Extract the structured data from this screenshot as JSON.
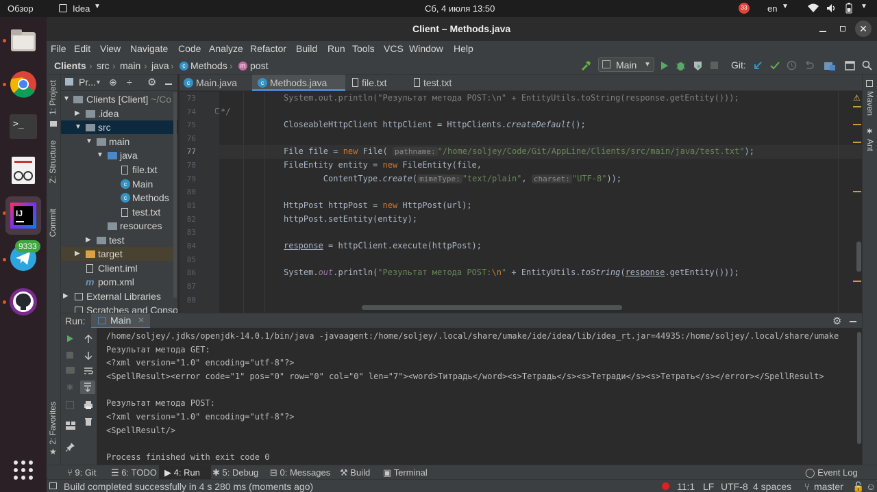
{
  "topbar": {
    "activities": "Обзор",
    "app_name": "Idea",
    "clock": "Сб, 4 июля  13:50",
    "lang": "en",
    "badge": "33"
  },
  "dock": {
    "telegram_badge": "9333"
  },
  "window": {
    "title": "Client – Methods.java"
  },
  "menu": [
    "File",
    "Edit",
    "View",
    "Navigate",
    "Code",
    "Analyze",
    "Refactor",
    "Build",
    "Run",
    "Tools",
    "VCS",
    "Window",
    "Help"
  ],
  "breadcrumbs": [
    "Clients",
    "src",
    "main",
    "java",
    "Methods",
    "post"
  ],
  "toolbar": {
    "run_config": "Main",
    "git_label": "Git:"
  },
  "project": {
    "header": "Pr...",
    "rows": [
      {
        "label": "Clients [Client]",
        "suffix": "~/Co"
      },
      {
        "label": ".idea"
      },
      {
        "label": "src"
      },
      {
        "label": "main"
      },
      {
        "label": "java"
      },
      {
        "label": "file.txt"
      },
      {
        "label": "Main"
      },
      {
        "label": "Methods"
      },
      {
        "label": "test.txt"
      },
      {
        "label": "resources"
      },
      {
        "label": "test"
      },
      {
        "label": "target"
      },
      {
        "label": "Client.iml"
      },
      {
        "label": "pom.xml"
      },
      {
        "label": "External Libraries"
      },
      {
        "label": "Scratches and Conso"
      }
    ]
  },
  "left_tabs": [
    "1: Project",
    "Z: Structure",
    "Commit",
    "2: Favorites"
  ],
  "right_tabs": [
    "Maven",
    "Ant"
  ],
  "tabs": [
    "Main.java",
    "Methods.java",
    "file.txt",
    "test.txt"
  ],
  "editor": {
    "line_numbers": [
      "73",
      "74",
      "75",
      "76",
      "77",
      "78",
      "79",
      "80",
      "81",
      "82",
      "83",
      "84",
      "85",
      "86",
      "87",
      "88"
    ],
    "l73_a": "System.",
    "l73_b": "out",
    "l73_c": ".println(",
    "l73_str": "\"Результат метода POST:\\n\"",
    "l73_d": " + EntityUtils.toString(response.getEntity()));",
    "l74": "*/",
    "l75_a": "CloseableHttpClient httpClient = HttpClients.",
    "l75_b": "createDefault",
    "l75_c": "();",
    "l77_a": "File file = ",
    "l77_kw": "new",
    "l77_b": " File(",
    "l77_hint": "pathname:",
    "l77_str": "\"/home/soljey/Code/Git/AppLine/Clients/src/main/java/test.txt\"",
    "l77_c": ");",
    "l78_a": "FileEntity entity = ",
    "l78_kw": "new",
    "l78_b": " FileEntity(file,",
    "l79_a": "        ContentType.",
    "l79_b": "create",
    "l79_c": "(",
    "l79_hint1": "mimeType:",
    "l79_str1": "\"text/plain\"",
    "l79_d": ",",
    "l79_hint2": "charset:",
    "l79_str2": "\"UTF-8\"",
    "l79_e": "));",
    "l81_a": "HttpPost httpPost = ",
    "l81_kw": "new",
    "l81_b": " HttpPost(url);",
    "l82": "httpPost.setEntity(entity);",
    "l84_a": "response",
    "l84_b": " = httpClient.execute(httpPost);",
    "l86_a": "System.",
    "l86_b": "out",
    "l86_c": ".println(",
    "l86_str": "\"Результат метода POST:",
    "l86_esc": "\\n",
    "l86_str2": "\"",
    "l86_d": " + EntityUtils.",
    "l86_e": "toString",
    "l86_f": "(",
    "l86_g": "response",
    "l86_h": ".getEntity()));"
  },
  "run": {
    "label": "Run:",
    "tab": "Main",
    "output": [
      "/home/soljey/.jdks/openjdk-14.0.1/bin/java -javaagent:/home/soljey/.local/share/umake/ide/idea/lib/idea_rt.jar=44935:/home/soljey/.local/share/umake",
      "Результат метода GET:",
      "<?xml version=\"1.0\" encoding=\"utf-8\"?>",
      "<SpellResult><error code=\"1\" pos=\"0\" row=\"0\" col=\"0\" len=\"7\"><word>Титрадь</word><s>Тетрадь</s><s>Тетради</s><s>Тетрать</s></error></SpellResult>",
      "",
      "Результат метода POST:",
      "<?xml version=\"1.0\" encoding=\"utf-8\"?>",
      "<SpellResult/>",
      "",
      "Process finished with exit code 0"
    ]
  },
  "tool_windows": [
    "9: Git",
    "6: TODO",
    "4: Run",
    "5: Debug",
    "0: Messages",
    "Build",
    "Terminal",
    "Event Log"
  ],
  "status": {
    "message": "Build completed successfully in 4 s 280 ms (moments ago)",
    "position": "11:1",
    "line_sep": "LF",
    "encoding": "UTF-8",
    "indent": "4 spaces",
    "branch": "master"
  },
  "colors": {
    "keyword": "#cc7832",
    "string": "#6a8759",
    "field": "#9876aa",
    "selection": "#0d293e",
    "accent": "#4a88c7"
  }
}
